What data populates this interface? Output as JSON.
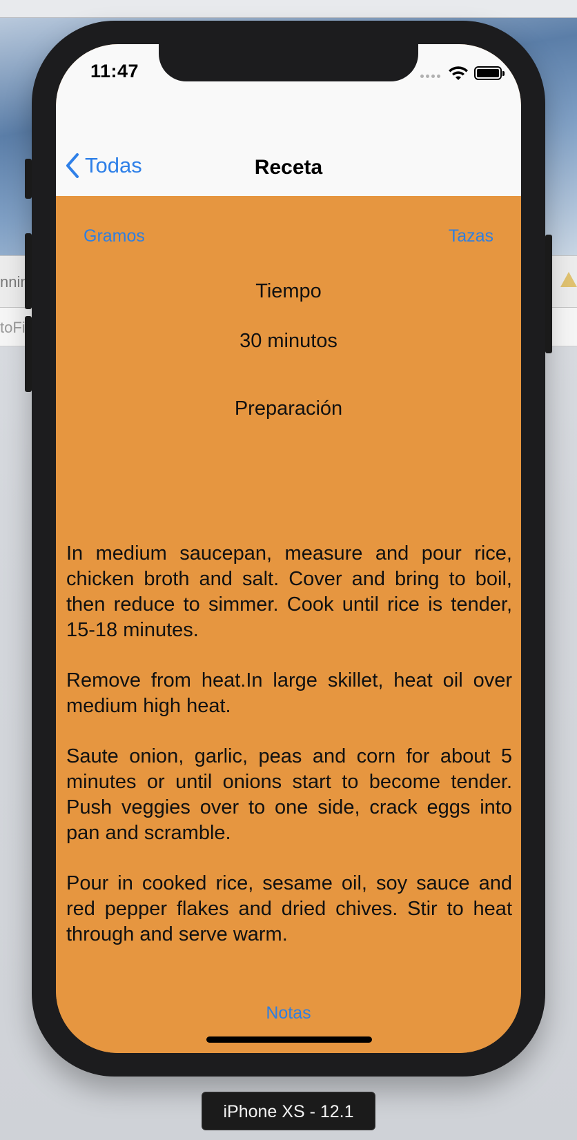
{
  "background": {
    "text_line_1": "nnin",
    "text_line_2": "toFi"
  },
  "status_bar": {
    "time": "11:47",
    "icons": [
      "signal-dots",
      "wifi-icon",
      "battery-icon"
    ]
  },
  "nav": {
    "back_label": "Todas",
    "title": "Receta"
  },
  "units": {
    "left": "Gramos",
    "right": "Tazas"
  },
  "recipe": {
    "time_heading": "Tiempo",
    "time_value": "30 minutos",
    "prep_heading": "Preparación",
    "paragraphs": [
      "In medium saucepan, measure and pour rice, chicken broth and salt. Cover and bring to boil, then reduce to simmer. Cook until rice is tender, 15-18 minutes.",
      "Remove from heat.In large skillet, heat oil over medium high heat.",
      "Saute onion, garlic, peas and corn for about 5 minutes or until onions start to become tender. Push veggies over to one side, crack eggs into pan and scramble.",
      "Pour in cooked rice, sesame oil, soy sauce and red pepper flakes and dried chives. Stir to heat through and serve warm."
    ]
  },
  "footer": {
    "notes_label": "Notas"
  },
  "simulator": {
    "device_label": "iPhone XS - 12.1"
  },
  "colors": {
    "content_bg": "#e69640",
    "accent": "#2f7fe0",
    "bar_bg": "#f9f9f9"
  }
}
